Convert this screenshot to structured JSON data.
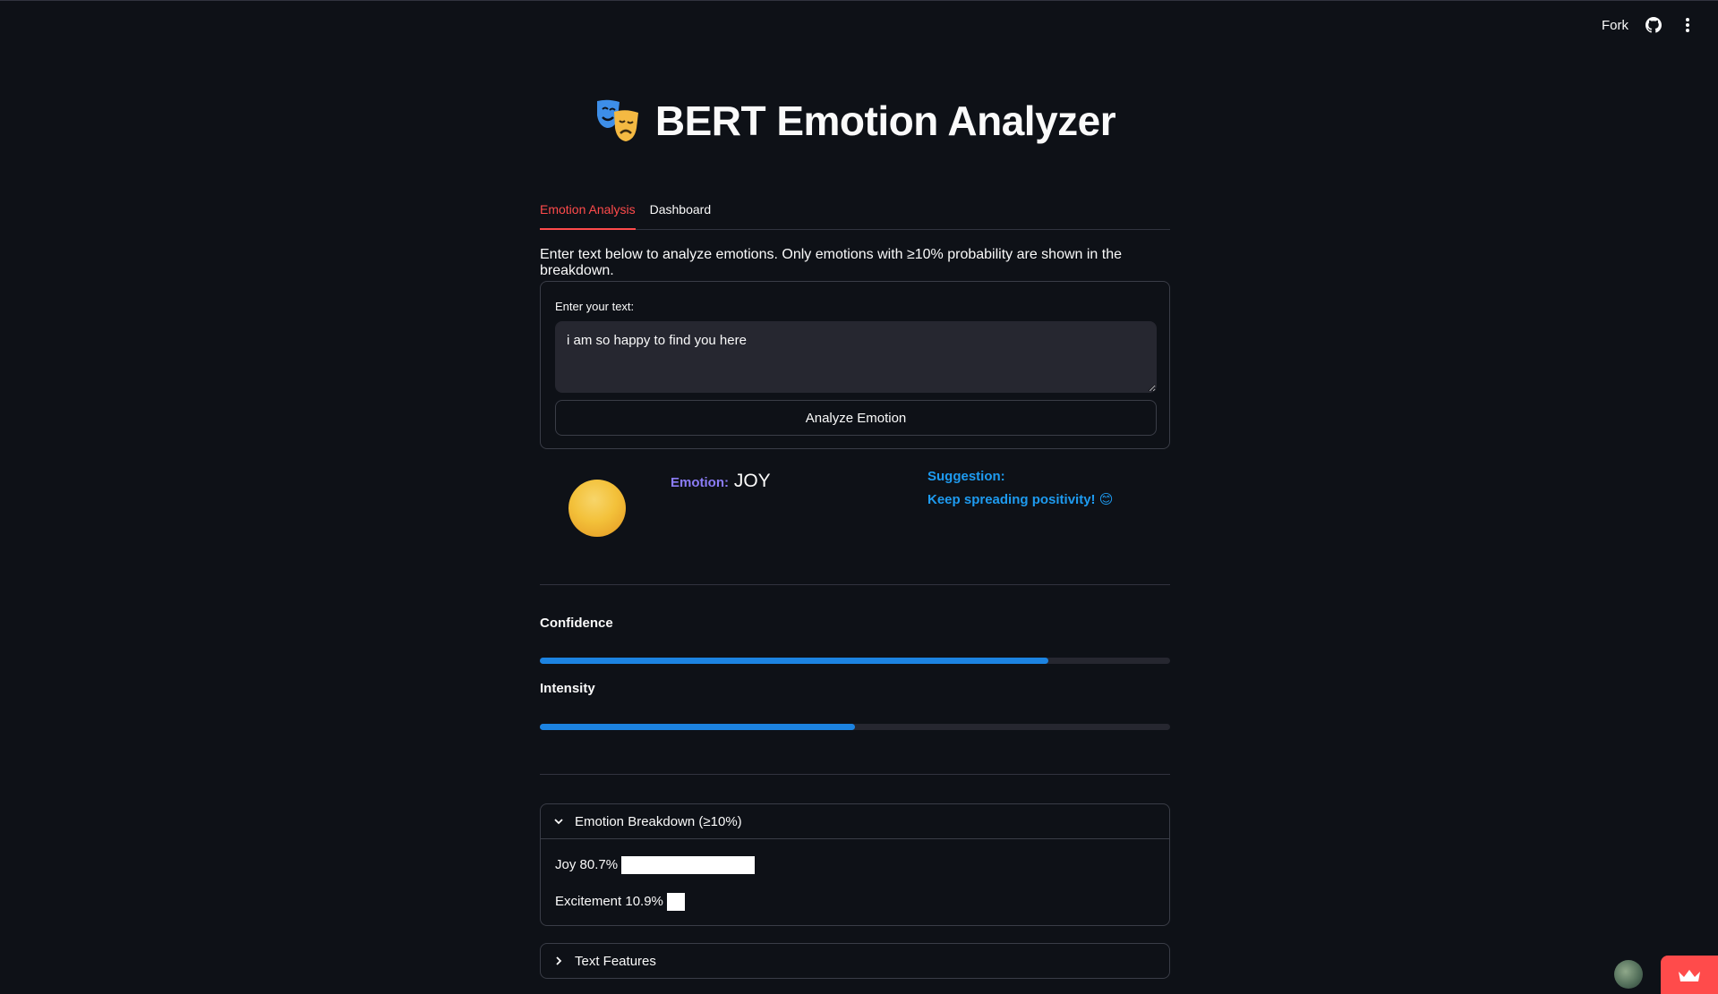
{
  "header": {
    "fork_label": "Fork"
  },
  "app": {
    "title": "BERT Emotion Analyzer"
  },
  "tabs": [
    {
      "label": "Emotion Analysis",
      "active": true
    },
    {
      "label": "Dashboard",
      "active": false
    }
  ],
  "intro_text": "Enter text below to analyze emotions. Only emotions with ≥10% probability are shown in the breakdown.",
  "form": {
    "input_label": "Enter your text:",
    "input_value": "i am so happy to find you here",
    "button_label": "Analyze Emotion"
  },
  "result": {
    "emotion_key": "Emotion:",
    "emotion_value": "JOY",
    "suggestion_key": "Suggestion:",
    "suggestion_text": "Keep spreading positivity! 😊"
  },
  "metrics": {
    "confidence_label": "Confidence",
    "confidence_value": 0.807,
    "intensity_label": "Intensity",
    "intensity_value": 0.5
  },
  "breakdown": {
    "title": "Emotion Breakdown (≥10%)",
    "items": [
      {
        "label": "Joy 80.7%",
        "value": 80.7
      },
      {
        "label": "Excitement 10.9%",
        "value": 10.9
      }
    ]
  },
  "text_features": {
    "title": "Text Features"
  },
  "colors": {
    "background": "#0e1117",
    "accent_red": "#ff4b4b",
    "progress_blue": "#1c83e1",
    "suggestion_blue": "#1e9bf0",
    "emotion_purple": "#8b7cf6"
  },
  "icons": {
    "github": "github-icon",
    "menu": "kebab-menu-icon",
    "title": "performing-arts-masks-icon",
    "chevron_down": "chevron-down-icon",
    "chevron_right": "chevron-right-icon",
    "crown": "crown-icon"
  }
}
